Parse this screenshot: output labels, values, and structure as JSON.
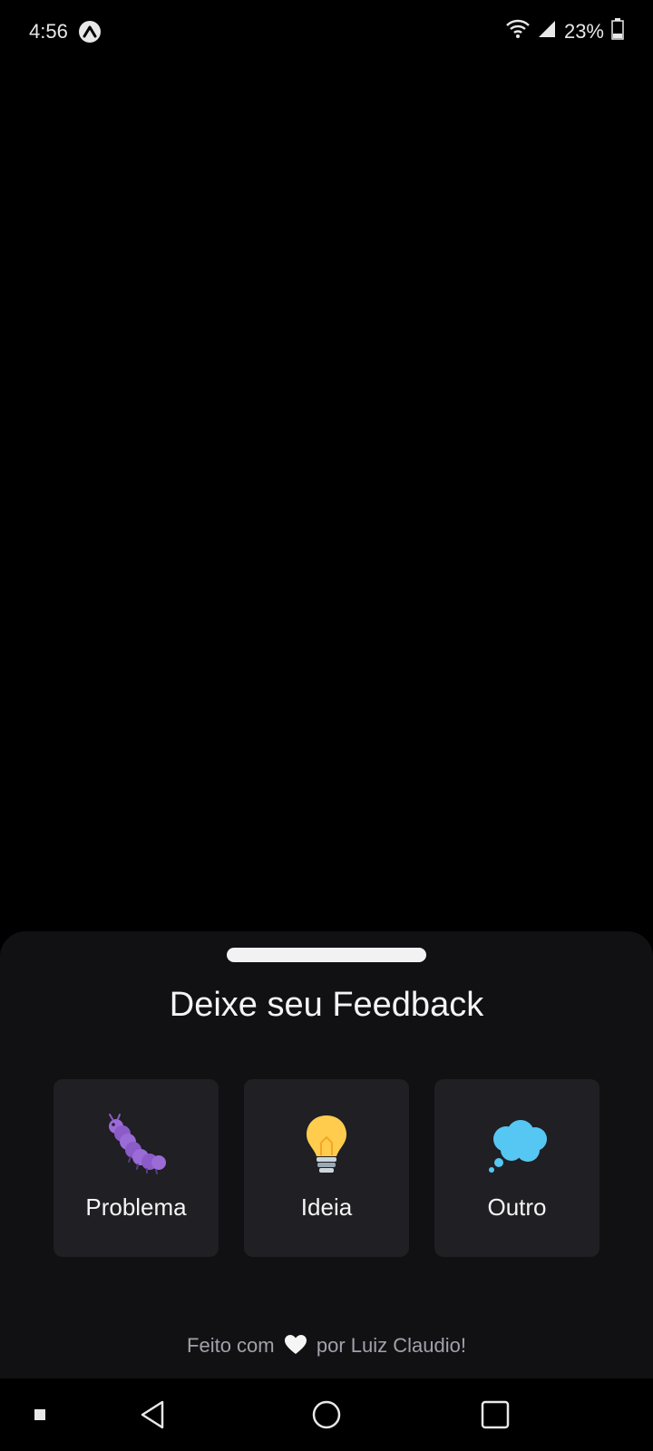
{
  "status_bar": {
    "time": "4:56",
    "battery_percent": "23%",
    "icons": [
      "expo-icon",
      "wifi-icon",
      "signal-icon",
      "battery-icon"
    ]
  },
  "sheet": {
    "title": "Deixe seu Feedback",
    "options": [
      {
        "label": "Problema",
        "icon": "caterpillar-icon"
      },
      {
        "label": "Ideia",
        "icon": "lightbulb-icon"
      },
      {
        "label": "Outro",
        "icon": "thought-bubble-icon"
      }
    ],
    "footer_prefix": "Feito com",
    "footer_suffix": "por Luiz Claudio!",
    "footer_icon": "heart-icon"
  },
  "nav_bar": {
    "icons": [
      "menu-dot-icon",
      "back-icon",
      "home-icon",
      "recents-icon"
    ]
  },
  "colors": {
    "background": "#000000",
    "sheet_background": "#111114",
    "option_background": "#1f1f24",
    "footer_text": "#a1a1aa"
  }
}
